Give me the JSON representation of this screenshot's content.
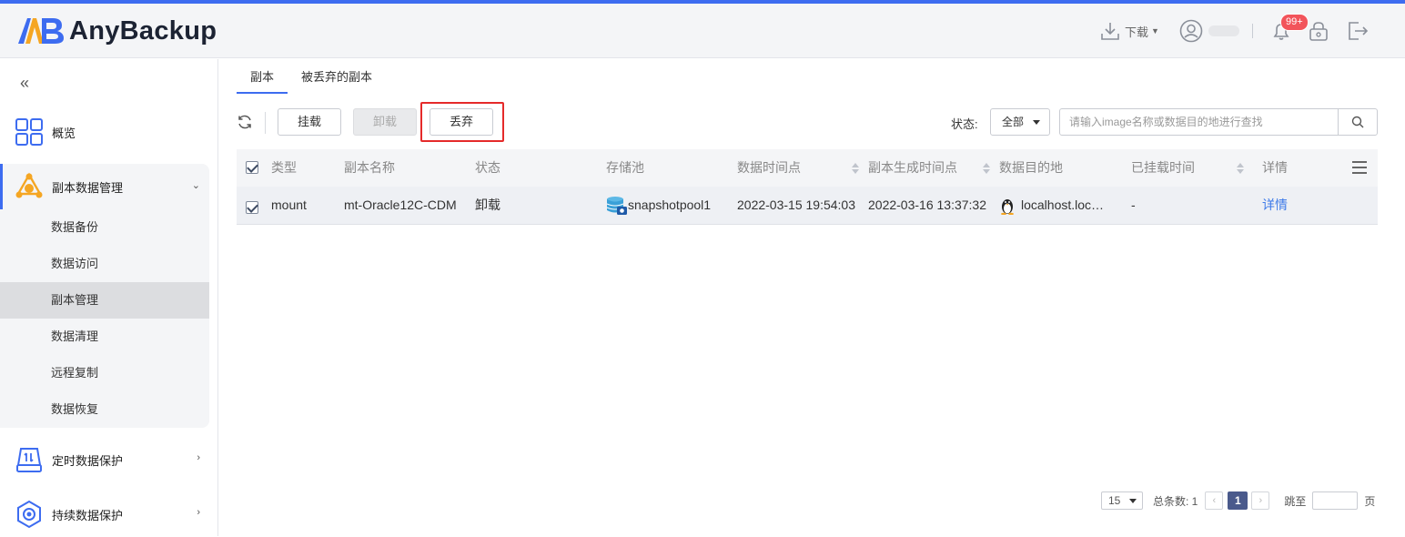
{
  "app": {
    "name": "AnyBackup"
  },
  "header": {
    "download_label": "下载",
    "notification_badge": "99+"
  },
  "sidebar": {
    "items": [
      {
        "label": "概览"
      },
      {
        "label": "副本数据管理"
      },
      {
        "label": "定时数据保护"
      },
      {
        "label": "持续数据保护"
      }
    ],
    "subitems": [
      {
        "label": "数据备份"
      },
      {
        "label": "数据访问"
      },
      {
        "label": "副本管理"
      },
      {
        "label": "数据清理"
      },
      {
        "label": "远程复制"
      },
      {
        "label": "数据恢复"
      }
    ]
  },
  "tabs": [
    {
      "label": "副本"
    },
    {
      "label": "被丢弃的副本"
    }
  ],
  "toolbar": {
    "mount_label": "挂载",
    "unmount_label": "卸载",
    "discard_label": "丢弃",
    "status_label": "状态:",
    "status_value": "全部",
    "search_placeholder": "请输入image名称或数据目的地进行查找"
  },
  "table": {
    "columns": [
      "类型",
      "副本名称",
      "状态",
      "存储池",
      "数据时间点",
      "副本生成时间点",
      "数据目的地",
      "已挂载时间",
      "详情"
    ],
    "rows": [
      {
        "type": "mount",
        "name": "mt-Oracle12C-CDM",
        "status": "卸载",
        "pool": "snapshotpool1",
        "data_time": "2022-03-15 19:54:03",
        "created_time": "2022-03-16 13:37:32",
        "destination": "localhost.loc…",
        "mounted_time": "-",
        "detail": "详情"
      }
    ]
  },
  "pager": {
    "page_size": "15",
    "total_label": "总条数: 1",
    "current_page": "1",
    "jump_label": "跳至",
    "page_suffix": "页"
  },
  "colors": {
    "accent": "#3d6cf0",
    "highlight_box": "#e52a2a",
    "link": "#3d7ae8"
  }
}
